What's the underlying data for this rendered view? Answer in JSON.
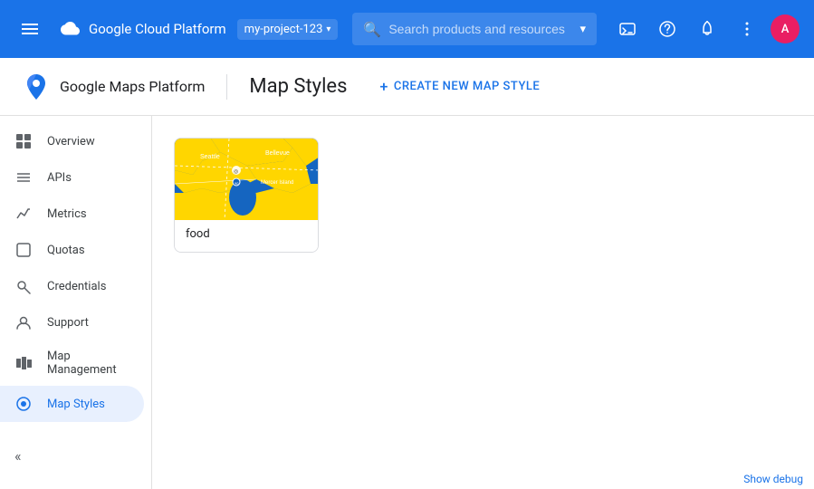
{
  "topbar": {
    "title": "Google Cloud Platform",
    "project": "my-project-123",
    "search_placeholder": "Search products and resources",
    "search_expand_icon": "▾"
  },
  "subheader": {
    "brand": "Google Maps Platform",
    "page_title": "Map Styles",
    "create_btn_label": "CREATE NEW MAP STYLE",
    "create_icon": "+"
  },
  "sidebar": {
    "items": [
      {
        "id": "overview",
        "label": "Overview",
        "icon": "☰",
        "active": false
      },
      {
        "id": "apis",
        "label": "APIs",
        "icon": "≡",
        "active": false
      },
      {
        "id": "metrics",
        "label": "Metrics",
        "icon": "▦",
        "active": false
      },
      {
        "id": "quotas",
        "label": "Quotas",
        "icon": "☐",
        "active": false
      },
      {
        "id": "credentials",
        "label": "Credentials",
        "icon": "🔑",
        "active": false
      },
      {
        "id": "support",
        "label": "Support",
        "icon": "👤",
        "active": false
      },
      {
        "id": "map-management",
        "label": "Map Management",
        "icon": "▦",
        "active": false
      },
      {
        "id": "map-styles",
        "label": "Map Styles",
        "icon": "◎",
        "active": true
      }
    ],
    "collapse_icon": "«"
  },
  "content": {
    "map_cards": [
      {
        "id": "food",
        "label": "food",
        "thumbnail_alt": "Seattle map thumbnail"
      }
    ]
  },
  "bottom": {
    "debug_label": "Show debug"
  },
  "colors": {
    "topbar_bg": "#1a73e8",
    "active_item": "#1a73e8",
    "active_item_bg": "#e8f0fe"
  }
}
